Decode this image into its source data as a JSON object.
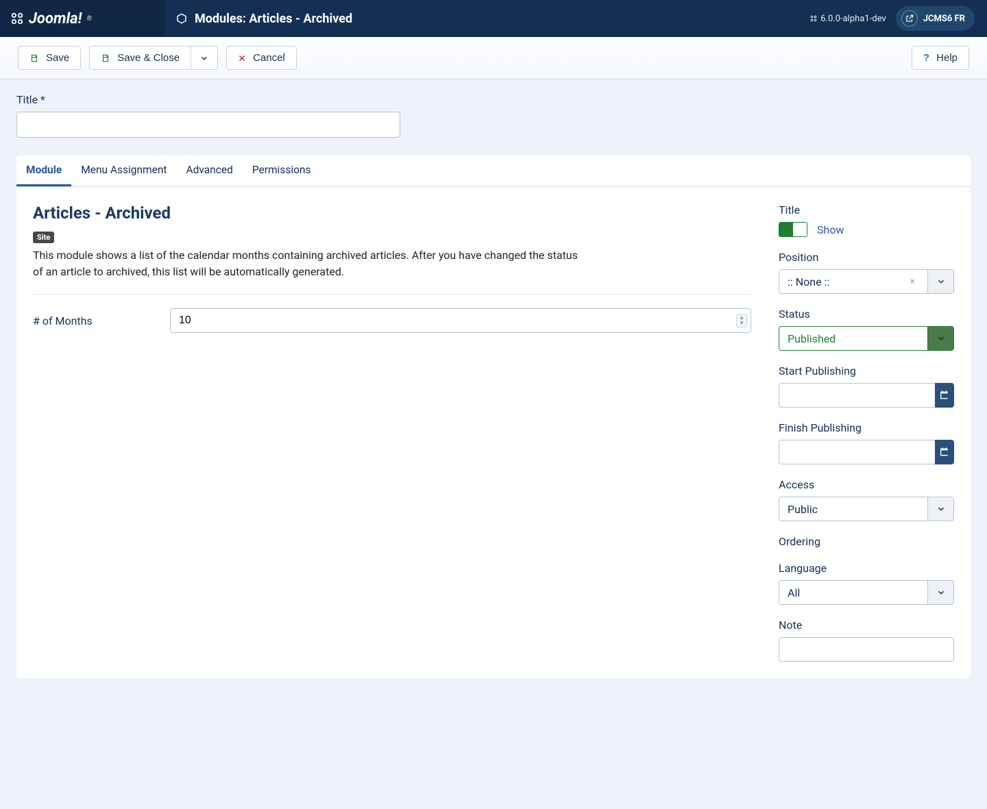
{
  "header": {
    "brand": "Joomla!",
    "page_icon": "cube",
    "page_title": "Modules: Articles - Archived",
    "version": "6.0.0-alpha1-dev",
    "user_label": "JCMS6 FR"
  },
  "toolbar": {
    "save": "Save",
    "save_close": "Save & Close",
    "cancel": "Cancel",
    "help": "Help"
  },
  "title_field": {
    "label": "Title *",
    "value": ""
  },
  "tabs": [
    "Module",
    "Menu Assignment",
    "Advanced",
    "Permissions"
  ],
  "active_tab": 0,
  "module": {
    "heading": "Articles - Archived",
    "badge": "Site",
    "description": "This module shows a list of the calendar months containing archived articles. After you have changed the status of an article to archived, this list will be automatically generated.",
    "fields": {
      "months_label": "# of Months",
      "months_value": "10"
    }
  },
  "sidebar": {
    "title": {
      "label": "Title",
      "toggle_text": "Show",
      "value": true
    },
    "position": {
      "label": "Position",
      "value": ":: None ::"
    },
    "status": {
      "label": "Status",
      "value": "Published"
    },
    "start_publishing": {
      "label": "Start Publishing",
      "value": ""
    },
    "finish_publishing": {
      "label": "Finish Publishing",
      "value": ""
    },
    "access": {
      "label": "Access",
      "value": "Public"
    },
    "ordering": {
      "label": "Ordering"
    },
    "language": {
      "label": "Language",
      "value": "All"
    },
    "note": {
      "label": "Note",
      "value": ""
    }
  }
}
